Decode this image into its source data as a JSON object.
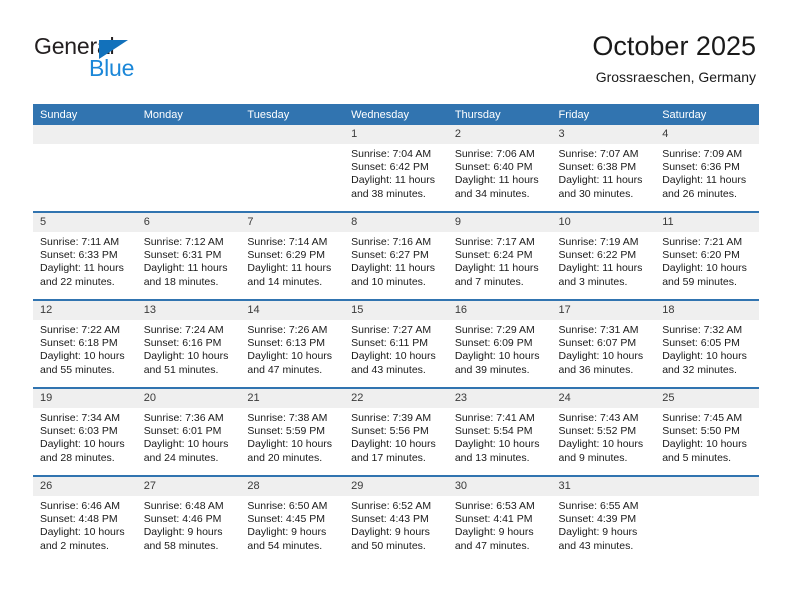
{
  "brand": {
    "name_top": "General",
    "name_bottom": "Blue",
    "triangle_color": "#1271bb",
    "top_color": "#231f20",
    "bottom_color": "#1b87d8"
  },
  "header": {
    "title": "October 2025",
    "subtitle": "Grossraeschen, Germany",
    "accent_color": "#3174b0"
  },
  "weekdays": [
    "Sunday",
    "Monday",
    "Tuesday",
    "Wednesday",
    "Thursday",
    "Friday",
    "Saturday"
  ],
  "labels": {
    "sunrise_prefix": "Sunrise:",
    "sunset_prefix": "Sunset:",
    "daylight_prefix": "Daylight:"
  },
  "weeks": [
    [
      {
        "day": "",
        "empty": true
      },
      {
        "day": "",
        "empty": true
      },
      {
        "day": "",
        "empty": true
      },
      {
        "day": "1",
        "sunrise": "Sunrise: 7:04 AM",
        "sunset": "Sunset: 6:42 PM",
        "daylight1": "Daylight: 11 hours",
        "daylight2": "and 38 minutes."
      },
      {
        "day": "2",
        "sunrise": "Sunrise: 7:06 AM",
        "sunset": "Sunset: 6:40 PM",
        "daylight1": "Daylight: 11 hours",
        "daylight2": "and 34 minutes."
      },
      {
        "day": "3",
        "sunrise": "Sunrise: 7:07 AM",
        "sunset": "Sunset: 6:38 PM",
        "daylight1": "Daylight: 11 hours",
        "daylight2": "and 30 minutes."
      },
      {
        "day": "4",
        "sunrise": "Sunrise: 7:09 AM",
        "sunset": "Sunset: 6:36 PM",
        "daylight1": "Daylight: 11 hours",
        "daylight2": "and 26 minutes."
      }
    ],
    [
      {
        "day": "5",
        "sunrise": "Sunrise: 7:11 AM",
        "sunset": "Sunset: 6:33 PM",
        "daylight1": "Daylight: 11 hours",
        "daylight2": "and 22 minutes."
      },
      {
        "day": "6",
        "sunrise": "Sunrise: 7:12 AM",
        "sunset": "Sunset: 6:31 PM",
        "daylight1": "Daylight: 11 hours",
        "daylight2": "and 18 minutes."
      },
      {
        "day": "7",
        "sunrise": "Sunrise: 7:14 AM",
        "sunset": "Sunset: 6:29 PM",
        "daylight1": "Daylight: 11 hours",
        "daylight2": "and 14 minutes."
      },
      {
        "day": "8",
        "sunrise": "Sunrise: 7:16 AM",
        "sunset": "Sunset: 6:27 PM",
        "daylight1": "Daylight: 11 hours",
        "daylight2": "and 10 minutes."
      },
      {
        "day": "9",
        "sunrise": "Sunrise: 7:17 AM",
        "sunset": "Sunset: 6:24 PM",
        "daylight1": "Daylight: 11 hours",
        "daylight2": "and 7 minutes."
      },
      {
        "day": "10",
        "sunrise": "Sunrise: 7:19 AM",
        "sunset": "Sunset: 6:22 PM",
        "daylight1": "Daylight: 11 hours",
        "daylight2": "and 3 minutes."
      },
      {
        "day": "11",
        "sunrise": "Sunrise: 7:21 AM",
        "sunset": "Sunset: 6:20 PM",
        "daylight1": "Daylight: 10 hours",
        "daylight2": "and 59 minutes."
      }
    ],
    [
      {
        "day": "12",
        "sunrise": "Sunrise: 7:22 AM",
        "sunset": "Sunset: 6:18 PM",
        "daylight1": "Daylight: 10 hours",
        "daylight2": "and 55 minutes."
      },
      {
        "day": "13",
        "sunrise": "Sunrise: 7:24 AM",
        "sunset": "Sunset: 6:16 PM",
        "daylight1": "Daylight: 10 hours",
        "daylight2": "and 51 minutes."
      },
      {
        "day": "14",
        "sunrise": "Sunrise: 7:26 AM",
        "sunset": "Sunset: 6:13 PM",
        "daylight1": "Daylight: 10 hours",
        "daylight2": "and 47 minutes."
      },
      {
        "day": "15",
        "sunrise": "Sunrise: 7:27 AM",
        "sunset": "Sunset: 6:11 PM",
        "daylight1": "Daylight: 10 hours",
        "daylight2": "and 43 minutes."
      },
      {
        "day": "16",
        "sunrise": "Sunrise: 7:29 AM",
        "sunset": "Sunset: 6:09 PM",
        "daylight1": "Daylight: 10 hours",
        "daylight2": "and 39 minutes."
      },
      {
        "day": "17",
        "sunrise": "Sunrise: 7:31 AM",
        "sunset": "Sunset: 6:07 PM",
        "daylight1": "Daylight: 10 hours",
        "daylight2": "and 36 minutes."
      },
      {
        "day": "18",
        "sunrise": "Sunrise: 7:32 AM",
        "sunset": "Sunset: 6:05 PM",
        "daylight1": "Daylight: 10 hours",
        "daylight2": "and 32 minutes."
      }
    ],
    [
      {
        "day": "19",
        "sunrise": "Sunrise: 7:34 AM",
        "sunset": "Sunset: 6:03 PM",
        "daylight1": "Daylight: 10 hours",
        "daylight2": "and 28 minutes."
      },
      {
        "day": "20",
        "sunrise": "Sunrise: 7:36 AM",
        "sunset": "Sunset: 6:01 PM",
        "daylight1": "Daylight: 10 hours",
        "daylight2": "and 24 minutes."
      },
      {
        "day": "21",
        "sunrise": "Sunrise: 7:38 AM",
        "sunset": "Sunset: 5:59 PM",
        "daylight1": "Daylight: 10 hours",
        "daylight2": "and 20 minutes."
      },
      {
        "day": "22",
        "sunrise": "Sunrise: 7:39 AM",
        "sunset": "Sunset: 5:56 PM",
        "daylight1": "Daylight: 10 hours",
        "daylight2": "and 17 minutes."
      },
      {
        "day": "23",
        "sunrise": "Sunrise: 7:41 AM",
        "sunset": "Sunset: 5:54 PM",
        "daylight1": "Daylight: 10 hours",
        "daylight2": "and 13 minutes."
      },
      {
        "day": "24",
        "sunrise": "Sunrise: 7:43 AM",
        "sunset": "Sunset: 5:52 PM",
        "daylight1": "Daylight: 10 hours",
        "daylight2": "and 9 minutes."
      },
      {
        "day": "25",
        "sunrise": "Sunrise: 7:45 AM",
        "sunset": "Sunset: 5:50 PM",
        "daylight1": "Daylight: 10 hours",
        "daylight2": "and 5 minutes."
      }
    ],
    [
      {
        "day": "26",
        "sunrise": "Sunrise: 6:46 AM",
        "sunset": "Sunset: 4:48 PM",
        "daylight1": "Daylight: 10 hours",
        "daylight2": "and 2 minutes."
      },
      {
        "day": "27",
        "sunrise": "Sunrise: 6:48 AM",
        "sunset": "Sunset: 4:46 PM",
        "daylight1": "Daylight: 9 hours",
        "daylight2": "and 58 minutes."
      },
      {
        "day": "28",
        "sunrise": "Sunrise: 6:50 AM",
        "sunset": "Sunset: 4:45 PM",
        "daylight1": "Daylight: 9 hours",
        "daylight2": "and 54 minutes."
      },
      {
        "day": "29",
        "sunrise": "Sunrise: 6:52 AM",
        "sunset": "Sunset: 4:43 PM",
        "daylight1": "Daylight: 9 hours",
        "daylight2": "and 50 minutes."
      },
      {
        "day": "30",
        "sunrise": "Sunrise: 6:53 AM",
        "sunset": "Sunset: 4:41 PM",
        "daylight1": "Daylight: 9 hours",
        "daylight2": "and 47 minutes."
      },
      {
        "day": "31",
        "sunrise": "Sunrise: 6:55 AM",
        "sunset": "Sunset: 4:39 PM",
        "daylight1": "Daylight: 9 hours",
        "daylight2": "and 43 minutes."
      },
      {
        "day": "",
        "empty": true
      }
    ]
  ]
}
